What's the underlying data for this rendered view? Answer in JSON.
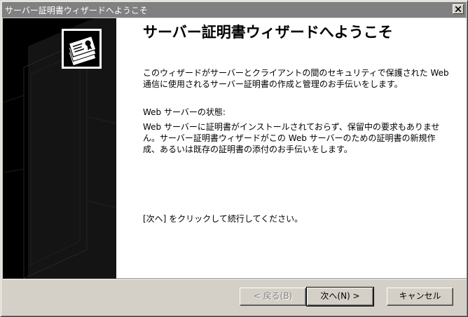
{
  "window": {
    "title": "サーバー証明書ウィザードへようこそ"
  },
  "main": {
    "heading": "サーバー証明書ウィザードへようこそ",
    "intro": "このウィザードがサーバーとクライアントの間のセキュリティで保護された Web 通信に使用されるサーバー証明書の作成と管理のお手伝いをします。",
    "status_label": "Web サーバーの状態:",
    "status_text": "Web サーバーに証明書がインストールされておらず、保留中の要求もありません。サーバー証明書ウィザードがこの Web サーバーのための証明書の新規作成、あるいは既存の証明書の添付のお手伝いをします。",
    "instruction": "[次へ] をクリックして続行してください。"
  },
  "buttons": {
    "back": "< 戻る(B)",
    "next": "次へ(N) >",
    "cancel": "キャンセル"
  },
  "icons": {
    "close": "close-icon",
    "wizard": "certificate-wizard-icon"
  },
  "colors": {
    "titlebar": "#808080",
    "face": "#d4d0c8",
    "sidebar": "#000000"
  }
}
